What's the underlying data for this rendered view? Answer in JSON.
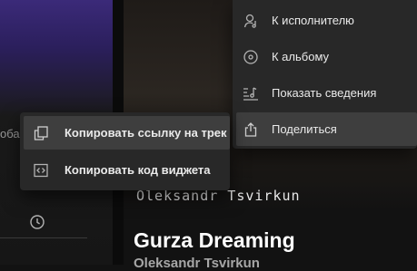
{
  "track": {
    "art_artist_text": "Oleksandr Tsvirkun",
    "title": "Gurza Dreaming",
    "artist": "Oleksandr Tsvirkun"
  },
  "left_panel": {
    "clipped_text": "оба",
    "clock_icon": "clock-icon"
  },
  "context_menu": {
    "items": [
      {
        "label": "К исполнителю",
        "icon": "artist-icon"
      },
      {
        "label": "К альбому",
        "icon": "album-icon"
      },
      {
        "label": "Показать сведения",
        "icon": "credits-icon"
      },
      {
        "label": "Поделиться",
        "icon": "share-icon",
        "highlighted": true
      }
    ]
  },
  "share_submenu": {
    "items": [
      {
        "label": "Копировать ссылку на трек",
        "icon": "copy-link-icon",
        "highlighted": true
      },
      {
        "label": "Копировать код виджета",
        "icon": "embed-code-icon"
      }
    ]
  }
}
